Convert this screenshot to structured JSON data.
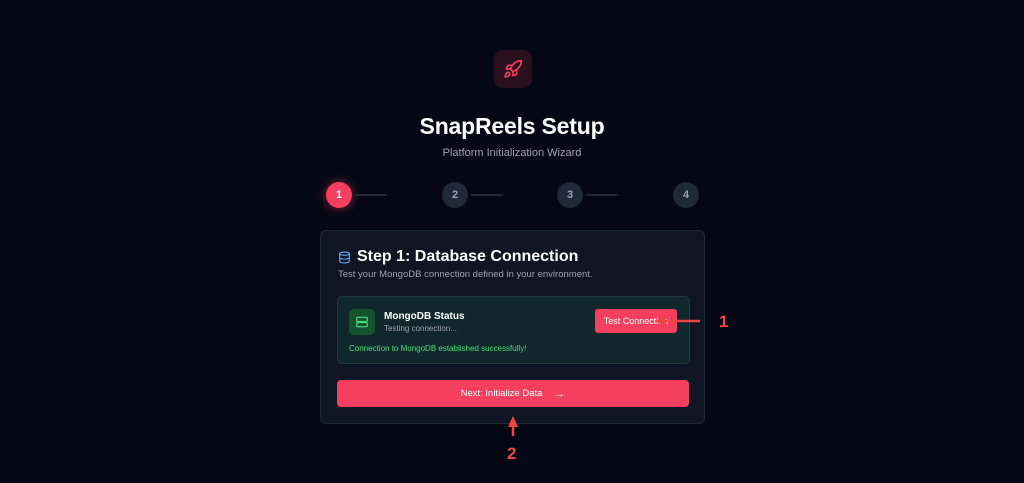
{
  "header": {
    "logo_icon": "rocket-icon",
    "title": "SnapReels Setup",
    "subtitle": "Platform Initialization Wizard"
  },
  "stepper": {
    "steps": [
      "1",
      "2",
      "3",
      "4"
    ],
    "active_step": 1
  },
  "card": {
    "icon": "database-icon",
    "title": "Step 1: Database Connection",
    "description": "Test your MongoDB connection defined in your environment.",
    "status": {
      "icon": "server-icon",
      "name": "MongoDB Status",
      "state": "Testing connection...",
      "message": "Connection to MongoDB established successfully!",
      "test_button": "Test Connection"
    },
    "next_button": "Next: Initialize Data",
    "next_icon": "arrow-right-icon"
  },
  "annotations": [
    "1",
    "2"
  ],
  "colors": {
    "accent": "#f43f5e",
    "success": "#4ade80",
    "background": "#050814",
    "card": "#0f1523"
  }
}
